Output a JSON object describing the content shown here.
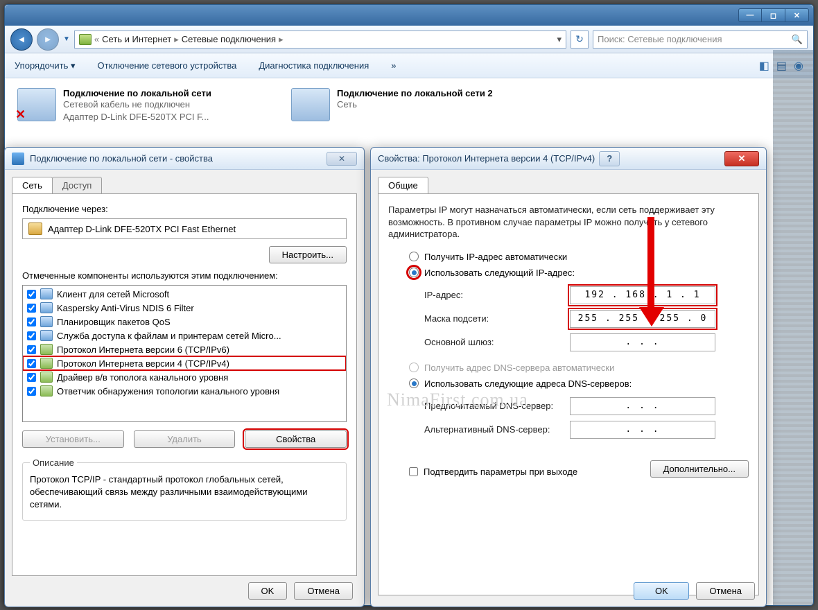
{
  "explorer": {
    "breadcrumb1": "Сеть и Интернет",
    "breadcrumb2": "Сетевые подключения",
    "search_placeholder": "Поиск: Сетевые подключения",
    "toolbar": {
      "organize": "Упорядочить ▾",
      "disable": "Отключение сетевого устройства",
      "diagnose": "Диагностика подключения",
      "more": "»"
    },
    "conn1": {
      "title": "Подключение по локальной сети",
      "line2": "Сетевой кабель не подключен",
      "line3": "Адаптер D-Link DFE-520TX PCI F..."
    },
    "conn2": {
      "title": "Подключение по локальной сети 2",
      "line2": "Сеть"
    }
  },
  "dlg1": {
    "title": "Подключение по локальной сети - свойства",
    "tab_net": "Сеть",
    "tab_access": "Доступ",
    "conn_via": "Подключение через:",
    "adapter": "Адаптер D-Link DFE-520TX PCI Fast Ethernet",
    "configure": "Настроить...",
    "components_label": "Отмеченные компоненты используются этим подключением:",
    "components": [
      "Клиент для сетей Microsoft",
      "Kaspersky Anti-Virus NDIS 6 Filter",
      "Планировщик пакетов QoS",
      "Служба доступа к файлам и принтерам сетей Micro...",
      "Протокол Интернета версии 6 (TCP/IPv6)",
      "Протокол Интернета версии 4 (TCP/IPv4)",
      "Драйвер в/в тополога канального уровня",
      "Ответчик обнаружения топологии канального уровня"
    ],
    "install": "Установить...",
    "remove": "Удалить",
    "properties": "Свойства",
    "desc_title": "Описание",
    "desc_text": "Протокол TCP/IP - стандартный протокол глобальных сетей, обеспечивающий связь между различными взаимодействующими сетями.",
    "ok": "OK",
    "cancel": "Отмена"
  },
  "dlg2": {
    "title": "Свойства: Протокол Интернета версии 4 (TCP/IPv4)",
    "tab_general": "Общие",
    "intro": "Параметры IP могут назначаться автоматически, если сеть поддерживает эту возможность. В противном случае параметры IP можно получить у сетевого администратора.",
    "radio_auto_ip": "Получить IP-адрес автоматически",
    "radio_static_ip": "Использовать следующий IP-адрес:",
    "ip_label": "IP-адрес:",
    "ip_value": "192 . 168 .   1  .   1",
    "mask_label": "Маска подсети:",
    "mask_value": "255 . 255 . 255 .   0",
    "gw_label": "Основной шлюз:",
    "gw_value": ".       .       .",
    "radio_auto_dns": "Получить адрес DNS-сервера автоматически",
    "radio_static_dns": "Использовать следующие адреса DNS-серверов:",
    "dns1_label": "Предпочитаемый DNS-сервер:",
    "dns2_label": "Альтернативный DNS-сервер:",
    "dns_empty": ".       .       .",
    "confirm": "Подтвердить параметры при выходе",
    "advanced": "Дополнительно...",
    "ok": "OK",
    "cancel": "Отмена"
  },
  "watermark": "NimaFirst.com.ua"
}
